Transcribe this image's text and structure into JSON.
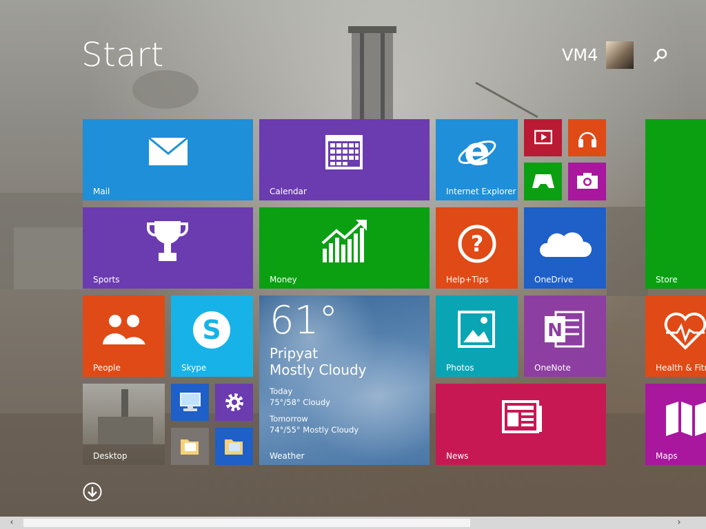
{
  "header": {
    "title": "Start",
    "user_name": "VM4"
  },
  "tiles": {
    "mail": "Mail",
    "calendar": "Calendar",
    "internet_explorer": "Internet Explorer",
    "sports": "Sports",
    "money": "Money",
    "help_tips": "Help+Tips",
    "onedrive": "OneDrive",
    "store": "Store",
    "people": "People",
    "skype": "Skype",
    "photos": "Photos",
    "onenote": "OneNote",
    "health": "Health & Fitne",
    "desktop": "Desktop",
    "news": "News",
    "maps": "Maps"
  },
  "weather": {
    "temperature": "61°",
    "city": "Pripyat",
    "condition": "Mostly Cloudy",
    "today_label": "Today",
    "today_forecast": "75°/58° Cloudy",
    "tomorrow_label": "Tomorrow",
    "tomorrow_forecast": "74°/55° Mostly Cloudy",
    "label": "Weather"
  },
  "colors": {
    "blue": "#1e8fd8",
    "purple": "#6b3bb0",
    "green": "#0aa012",
    "orange": "#e04a16",
    "teal": "#0aa5b4",
    "onenote": "#8d3ea1",
    "news": "#c81854",
    "maps": "#a8179e",
    "red_small": "#ba1a33",
    "skype": "#17b3e8"
  },
  "icons": [
    "mail-icon",
    "calendar-icon",
    "ie-icon",
    "video-icon",
    "music-icon",
    "games-icon",
    "camera-icon",
    "trophy-icon",
    "money-chart-icon",
    "help-icon",
    "cloud-icon",
    "people-icon",
    "skype-icon",
    "photos-icon",
    "onenote-icon",
    "heart-icon",
    "computer-icon",
    "gear-icon",
    "folder-icon",
    "news-icon",
    "maps-icon",
    "search-icon",
    "down-arrow-icon"
  ]
}
